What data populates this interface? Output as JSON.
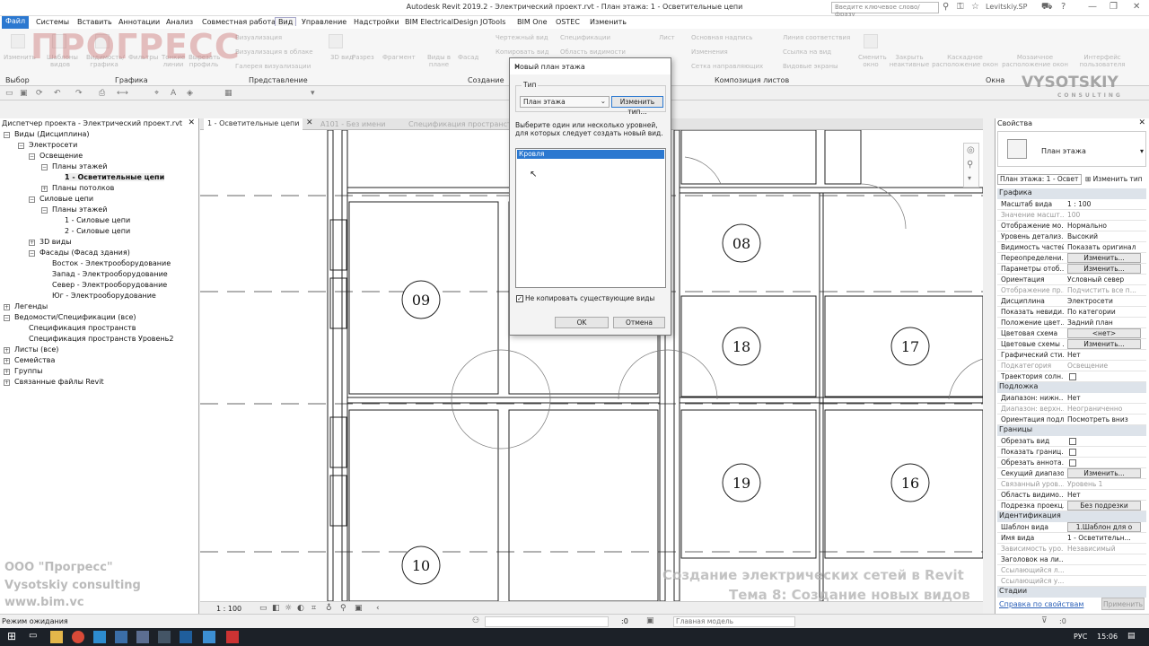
{
  "titlebar": {
    "title": "Autodesk Revit 2019.2 - Электрический проект.rvt - План этажа: 1 - Осветительные цепи",
    "search_placeholder": "Введите ключевое слово/фразу",
    "user": "Levitskiy.SP"
  },
  "menu": [
    "Файл",
    "Системы",
    "Вставить",
    "Аннотации",
    "Анализ",
    "Совместная работа",
    "Вид",
    "Управление",
    "Надстройки",
    "BIM ElectricalDesign",
    "JOTools",
    "BIM One",
    "OSTEC",
    "Изменить"
  ],
  "ribbon": {
    "tools": [
      "Изменить",
      "Шаблоны видов",
      "Видимость/ графика",
      "Фильтры",
      "Тонкие линии",
      "Вырезать профиль",
      "Визуализация",
      "Визуализация в облаке",
      "Галерея визуализации",
      "3D вид",
      "Разрез",
      "Фрагмент",
      "Виды в плане",
      "Фасад",
      "Копировать вид",
      "Чертежный вид",
      "Дублировать",
      "Легенды",
      "Спецификации",
      "Область видимости",
      "Лист",
      "Основная надпись",
      "Изменения",
      "Сетка направляющих",
      "Линия соответствия",
      "Ссылка на вид",
      "Видовые экраны",
      "Сменить окно",
      "Закрыть неактивные",
      "Каскадное расположение окон",
      "Мозаичное расположение окон",
      "Интерфейс пользователя"
    ],
    "panels": [
      "Выбор",
      "Графика",
      "Представление",
      "Создание",
      "Композиция листов",
      "Окна"
    ]
  },
  "browser": {
    "title": "Диспетчер проекта - Электрический проект.rvt",
    "items": [
      {
        "label": "Виды (Дисциплина)",
        "level": 0,
        "exp": "-"
      },
      {
        "label": "Электросети",
        "level": 1,
        "exp": "-"
      },
      {
        "label": "Освещение",
        "level": 2,
        "exp": "-"
      },
      {
        "label": "Планы этажей",
        "level": 3,
        "exp": "-"
      },
      {
        "label": "1 - Осветительные цепи",
        "level": 4,
        "exp": "",
        "bold": true
      },
      {
        "label": "Планы потолков",
        "level": 3,
        "exp": "+"
      },
      {
        "label": "Силовые цепи",
        "level": 2,
        "exp": "-"
      },
      {
        "label": "Планы этажей",
        "level": 3,
        "exp": "-"
      },
      {
        "label": "1 - Силовые цепи",
        "level": 4,
        "exp": ""
      },
      {
        "label": "2 - Силовые цепи",
        "level": 4,
        "exp": ""
      },
      {
        "label": "3D виды",
        "level": 2,
        "exp": "+"
      },
      {
        "label": "Фасады (Фасад здания)",
        "level": 2,
        "exp": "-"
      },
      {
        "label": "Восток - Электрооборудование",
        "level": 3,
        "exp": ""
      },
      {
        "label": "Запад - Электрооборудование",
        "level": 3,
        "exp": ""
      },
      {
        "label": "Север - Электрооборудование",
        "level": 3,
        "exp": ""
      },
      {
        "label": "Юг - Электрооборудование",
        "level": 3,
        "exp": ""
      },
      {
        "label": "Легенды",
        "level": 0,
        "exp": "+"
      },
      {
        "label": "Ведомости/Спецификации (все)",
        "level": 0,
        "exp": "-"
      },
      {
        "label": "Спецификация пространств",
        "level": 1,
        "exp": ""
      },
      {
        "label": "Спецификация пространств Уровень2",
        "level": 1,
        "exp": ""
      },
      {
        "label": "Листы (все)",
        "level": 0,
        "exp": "+"
      },
      {
        "label": "Семейства",
        "level": 0,
        "exp": "+"
      },
      {
        "label": "Группы",
        "level": 0,
        "exp": "+"
      },
      {
        "label": "Связанные файлы Revit",
        "level": 0,
        "exp": "+"
      }
    ]
  },
  "tabs": [
    "1 - Осветительные цепи",
    "A101 - Без имени",
    "Спецификация пространств"
  ],
  "rooms": [
    "08",
    "09",
    "18",
    "17",
    "19",
    "16",
    "10"
  ],
  "dialog": {
    "title": "Новый план этажа",
    "type_label": "Тип",
    "type_value": "План этажа",
    "edit_type": "Изменить тип...",
    "instruction": "Выберите один или несколько уровней, для которых следует создать новый вид.",
    "levels": [
      "Кровля"
    ],
    "no_copy_label": "Не копировать существующие виды",
    "no_copy_checked": true,
    "ok": "OK",
    "cancel": "Отмена"
  },
  "properties": {
    "title": "Свойства",
    "family": "План этажа",
    "selector": "План этажа: 1 - Освет",
    "edit_type": "Изменить тип",
    "help_link": "Справка по свойствам",
    "apply": "Применить",
    "rows": [
      {
        "section": "Графика"
      },
      {
        "k": "Масштаб вида",
        "v": "1 : 100"
      },
      {
        "k": "Значение масшт...",
        "v": "100",
        "grey": true
      },
      {
        "k": "Отображение мо...",
        "v": "Нормально"
      },
      {
        "k": "Уровень детализ...",
        "v": "Высокий"
      },
      {
        "k": "Видимость частей",
        "v": "Показать оригинал"
      },
      {
        "k": "Переопределени...",
        "btn": "Изменить..."
      },
      {
        "k": "Параметры отоб...",
        "btn": "Изменить..."
      },
      {
        "k": "Ориентация",
        "v": "Условный север"
      },
      {
        "k": "Отображение пр...",
        "v": "Подчистить все п...",
        "grey": true
      },
      {
        "k": "Дисциплина",
        "v": "Электросети"
      },
      {
        "k": "Показать невиди...",
        "v": "По категории"
      },
      {
        "k": "Положение цвет...",
        "v": "Задний план"
      },
      {
        "k": "Цветовая схема",
        "btn": "<нет>"
      },
      {
        "k": "Цветовые схемы ...",
        "btn": "Изменить..."
      },
      {
        "k": "Графический сти...",
        "v": "Нет"
      },
      {
        "k": "Подкатегория",
        "v": "Освещение",
        "grey": true
      },
      {
        "k": "Траектория солн...",
        "chk": false
      },
      {
        "section": "Подложка"
      },
      {
        "k": "Диапазон: нижн...",
        "v": "Нет"
      },
      {
        "k": "Диапазон: верхн...",
        "v": "Неограниченно",
        "grey": true
      },
      {
        "k": "Ориентация подл...",
        "v": "Посмотреть вниз"
      },
      {
        "section": "Границы"
      },
      {
        "k": "Обрезать вид",
        "chk": false
      },
      {
        "k": "Показать границ...",
        "chk": false
      },
      {
        "k": "Обрезать аннота...",
        "chk": false
      },
      {
        "k": "Секущий диапазон",
        "btn": "Изменить..."
      },
      {
        "k": "Связанный уров...",
        "v": "Уровень 1",
        "grey": true
      },
      {
        "k": "Область видимо...",
        "v": "Нет"
      },
      {
        "k": "Подрезка проекц...",
        "btn": "Без подрезки"
      },
      {
        "section": "Идентификация"
      },
      {
        "k": "Шаблон вида",
        "btn": "1.Шаблон для о"
      },
      {
        "k": "Имя вида",
        "v": "1 - Осветительн..."
      },
      {
        "k": "Зависимость уро...",
        "v": "Независимый",
        "grey": true
      },
      {
        "k": "Заголовок на ли...",
        "v": ""
      },
      {
        "k": "Ссылающийся л...",
        "v": "",
        "grey": true
      },
      {
        "k": "Ссылающийся у...",
        "v": "",
        "grey": true
      },
      {
        "section": "Стадии"
      }
    ]
  },
  "viewcontrol": {
    "scale": "1 : 100"
  },
  "status": {
    "text": "Режим ожидания",
    "count": ":0",
    "model": "Главная модель"
  },
  "taskbar": {
    "lang": "РУС",
    "time": "15:06"
  },
  "watermarks": {
    "logo_text": "ПРОГРЕСС",
    "vysotskiy": "VYSOTSKIY",
    "consulting": "CONSULTING",
    "company": "ООО \"Прогресс\"",
    "company2": "Vysotskiy consulting",
    "site": "www.bim.vc",
    "course": "Создание электрических сетей в Revit",
    "topic": "Тема 8: Создание новых видов"
  }
}
